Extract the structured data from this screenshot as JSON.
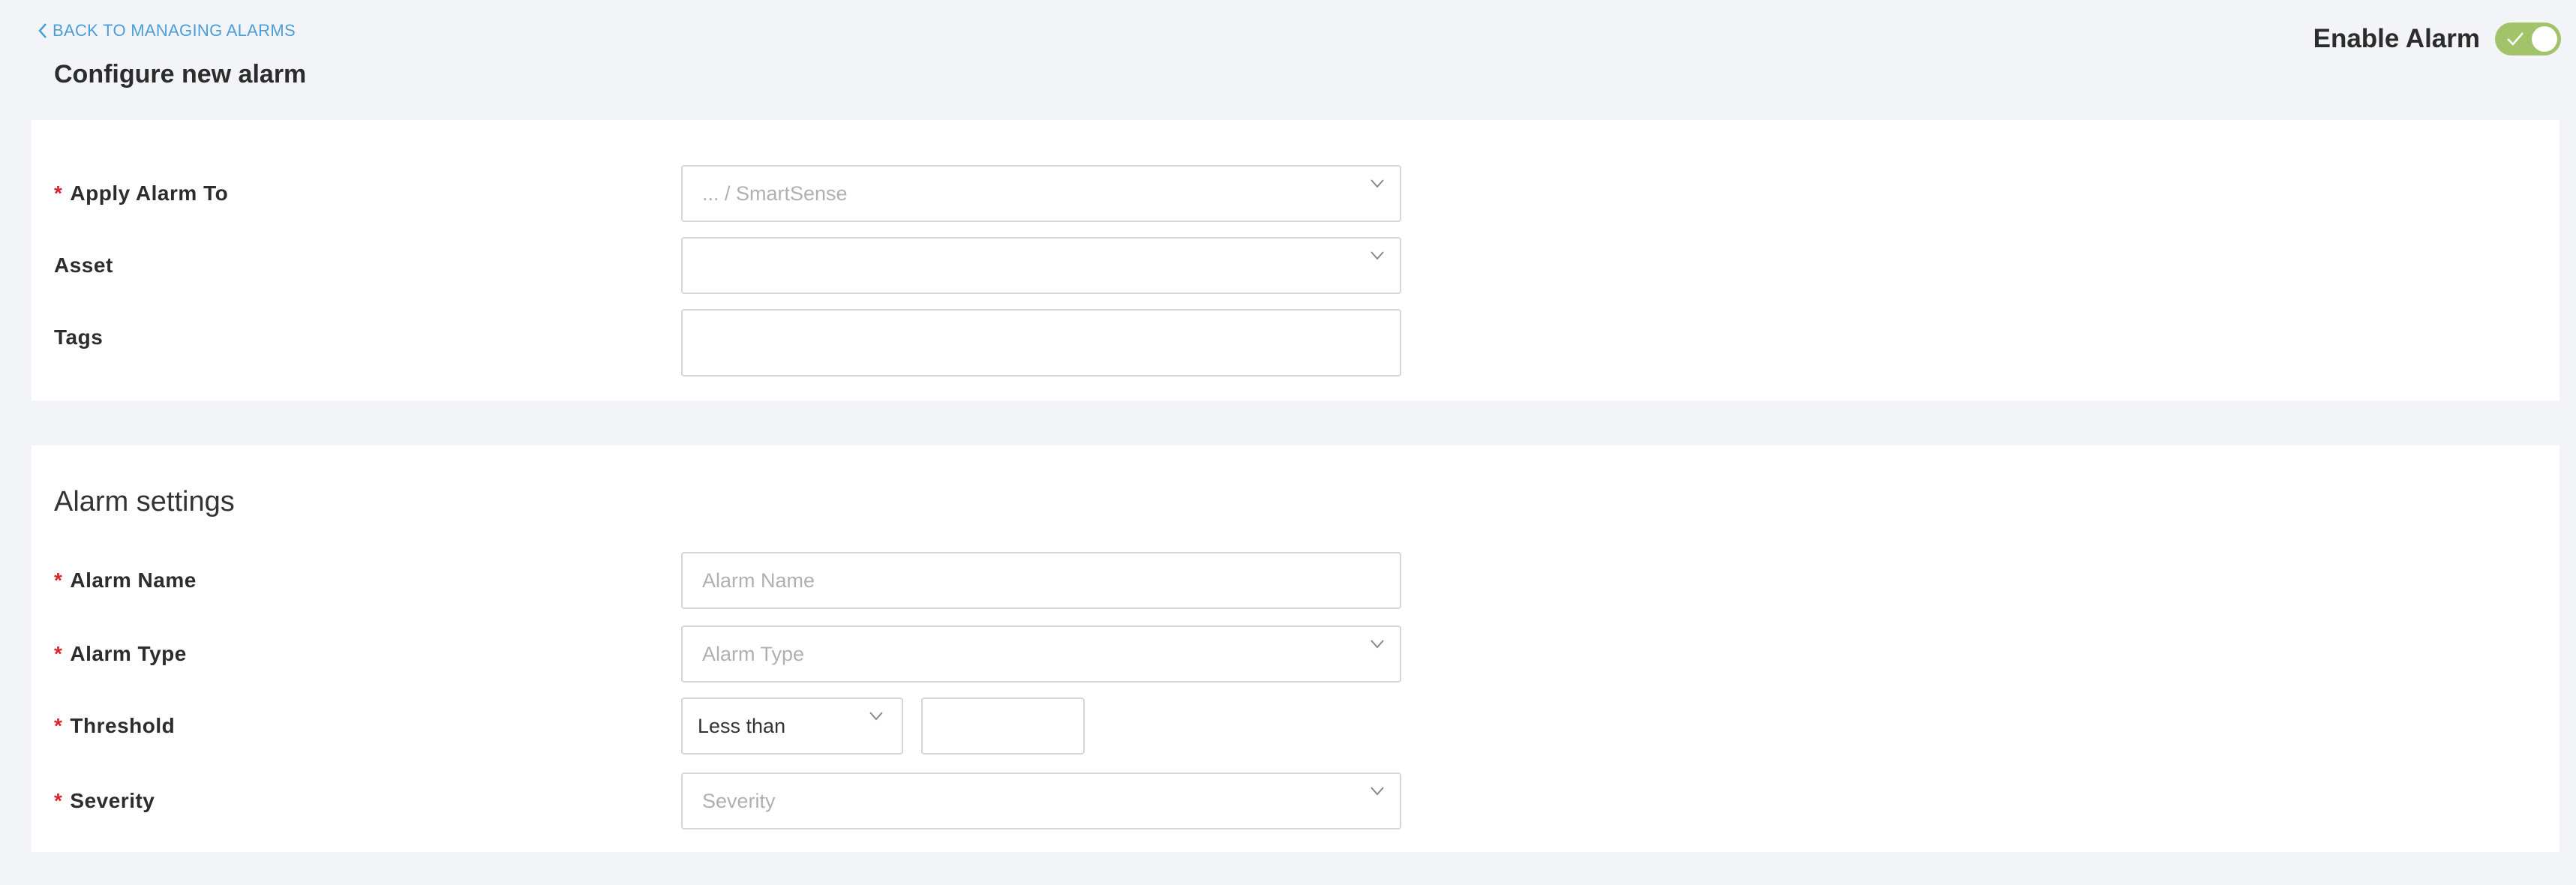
{
  "header": {
    "back_label": "BACK TO MANAGING ALARMS",
    "title": "Configure new alarm",
    "enable_label": "Enable Alarm",
    "enable_on": true,
    "toggle_color": "#a3c36a"
  },
  "target_section": {
    "apply_to": {
      "label": "Apply Alarm To",
      "required": "*",
      "value": "... / SmartSense"
    },
    "asset": {
      "label": "Asset",
      "value": ""
    },
    "tags": {
      "label": "Tags",
      "value": ""
    }
  },
  "settings_section": {
    "title": "Alarm settings",
    "alarm_name": {
      "label": "Alarm Name",
      "required": "*",
      "placeholder": "Alarm Name"
    },
    "alarm_type": {
      "label": "Alarm Type",
      "required": "*",
      "placeholder": "Alarm Type"
    },
    "threshold": {
      "label": "Threshold",
      "required": "*",
      "operator": "Less than",
      "value": ""
    },
    "severity": {
      "label": "Severity",
      "required": "*",
      "placeholder": "Severity"
    }
  },
  "colors": {
    "link": "#4a9fd8",
    "required": "#d9262c",
    "background": "#f3f4f7"
  }
}
